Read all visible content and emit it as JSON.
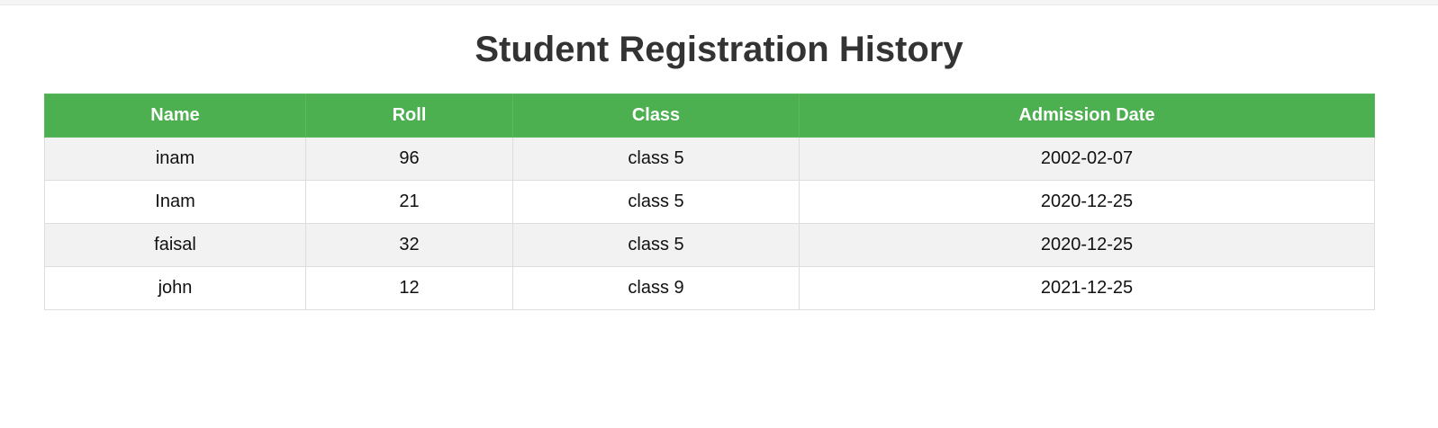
{
  "page": {
    "title": "Student Registration History"
  },
  "table": {
    "headers": [
      "Name",
      "Roll",
      "Class",
      "Admission Date"
    ],
    "rows": [
      [
        "inam",
        "96",
        "class 5",
        "2002-02-07"
      ],
      [
        "Inam",
        "21",
        "class 5",
        "2020-12-25"
      ],
      [
        "faisal",
        "32",
        "class 5",
        "2020-12-25"
      ],
      [
        "john",
        "12",
        "class 9",
        "2021-12-25"
      ]
    ]
  },
  "colors": {
    "header_bg": "#4caf50",
    "header_text": "#ffffff",
    "title_text": "#333333",
    "row_alt_bg": "#f2f2f2"
  }
}
